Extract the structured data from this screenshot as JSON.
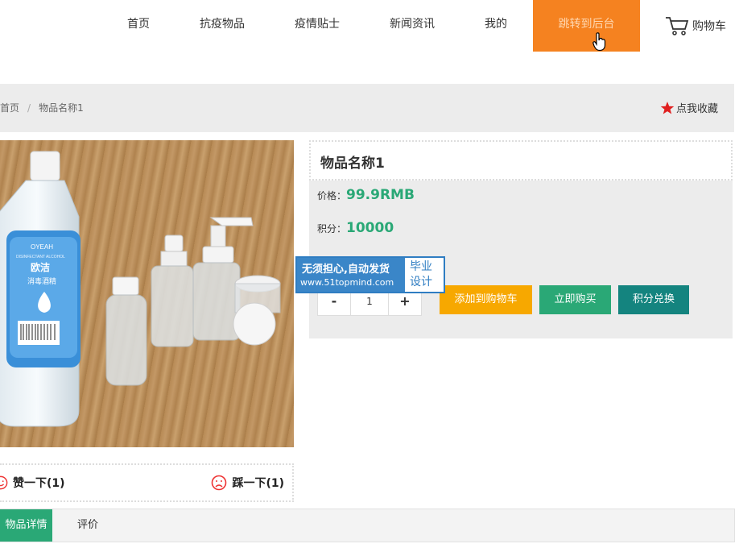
{
  "nav": {
    "items": [
      "首页",
      "抗疫物品",
      "疫情贴士",
      "新闻资讯",
      "我的"
    ],
    "active_item": "跳转到后台",
    "cart_label": "购物车"
  },
  "breadcrumb": {
    "home": "首页",
    "separator": "/",
    "current": "物品名称1"
  },
  "favorite_label": "点我收藏",
  "product": {
    "name": "物品名称1",
    "price_label": "价格：",
    "price_value": "99.9RMB",
    "points_label": "积分：",
    "points_value": "10000",
    "quantity": "1",
    "minus": "-",
    "plus": "+",
    "image_text": {
      "brand": "OYEAH",
      "brand_sub": "DISINFECTANT ALCOHOL",
      "name_cn": "欧洁",
      "desc_cn": "消毒酒精"
    }
  },
  "buttons": {
    "add_to_cart": "添加到购物车",
    "buy_now": "立即购买",
    "redeem": "积分兑换"
  },
  "votes": {
    "like": "赞一下(1)",
    "dislike": "踩一下(1)"
  },
  "tabs": [
    "物品详情",
    "评价"
  ],
  "ad": {
    "line1": "无须担心,自动发货",
    "line2": "www.51topmind.com",
    "side1": "毕业",
    "side2": "设计"
  },
  "colors": {
    "accent_orange": "#f58220",
    "green": "#2aa876",
    "yellow": "#f7a800",
    "teal": "#14847f",
    "favorite_star": "#e02020"
  }
}
